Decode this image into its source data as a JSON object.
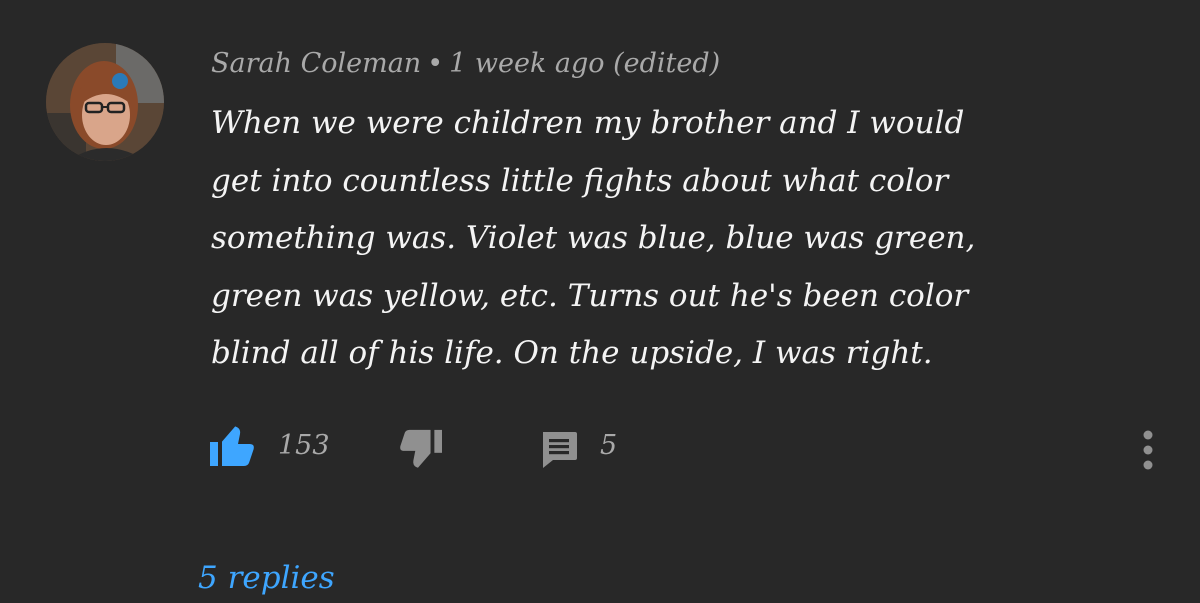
{
  "comment": {
    "author": "Sarah Coleman",
    "separator": "•",
    "time": "1 week ago (edited)",
    "body_lines": [
      "When we were children my brother and I would",
      "get into countless little fights about what color",
      "something was. Violet was blue, blue was green,",
      "green was yellow, etc. Turns out he's been color",
      "blind all of his life. On the upside, I was right."
    ],
    "likes": "153",
    "reply_count": "5",
    "replies_label": "5 replies"
  },
  "icons": {
    "like": "thumbs-up-icon",
    "dislike": "thumbs-down-icon",
    "reply": "comment-icon",
    "more": "more-vertical-icon"
  },
  "colors": {
    "background": "#282828",
    "text": "#f4f4f4",
    "muted": "#a9a9a9",
    "accent": "#3ea6ff",
    "like_active": "#3ea6ff"
  }
}
